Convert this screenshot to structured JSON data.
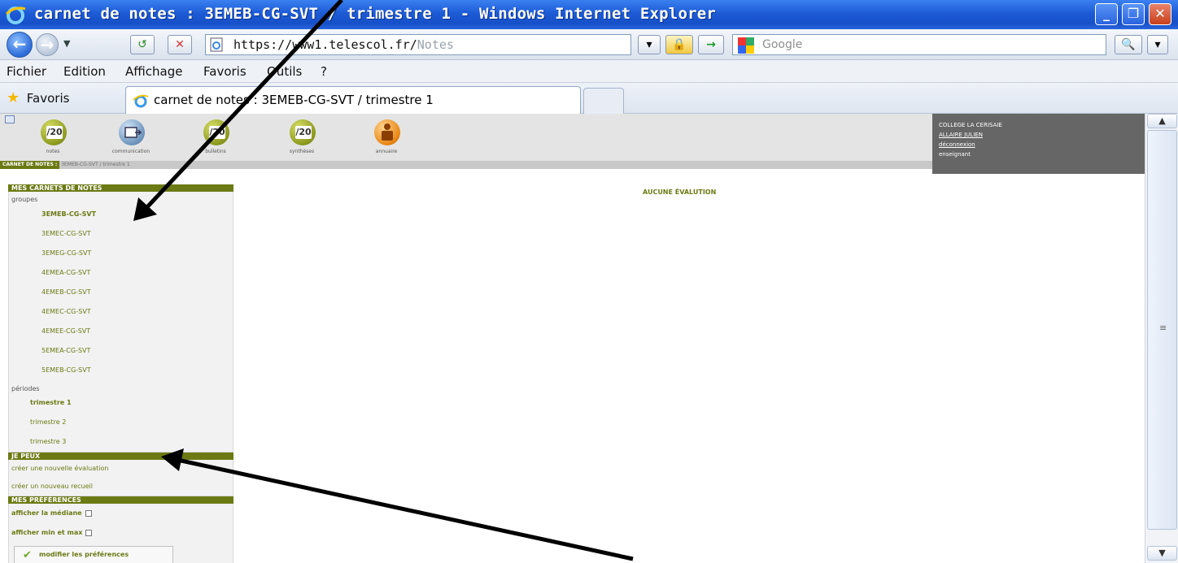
{
  "window": {
    "title": "carnet de notes : 3EMEB-CG-SVT / trimestre 1 - Windows Internet Explorer",
    "controls": [
      "_",
      "❐",
      "✕"
    ]
  },
  "addressbar": {
    "url_main": "https://www1.telescol.fr/",
    "url_tail": "Notes",
    "search_placeholder": "Google"
  },
  "menubar": [
    "Fichier",
    "Edition",
    "Affichage",
    "Favoris",
    "Outils",
    "?"
  ],
  "favbar": {
    "favorites_label": "Favoris",
    "tab_label": "carnet de notes : 3EMEB-CG-SVT / trimestre 1"
  },
  "app": {
    "nav": [
      {
        "label": "notes",
        "icon": "grade-icon",
        "mark": "/20"
      },
      {
        "label": "communication",
        "icon": "communication-icon",
        "mark": ""
      },
      {
        "label": "bulletins",
        "icon": "grade-icon",
        "mark": "/20"
      },
      {
        "label": "synthèses",
        "icon": "grade-icon",
        "mark": "/20"
      },
      {
        "label": "annuaire",
        "icon": "person-icon",
        "mark": ""
      }
    ],
    "breadcrumb": {
      "section": "CARNET DE NOTES :",
      "path": "3EMEB-CG-SVT / trimestre 1"
    },
    "college": {
      "name": "COLLEGE LA CERISAIE",
      "user": "ALLAIRE JULIEN",
      "logout": "déconnexion",
      "role": "enseignant"
    },
    "sidebar": {
      "carnets_header": "MES CARNETS DE NOTES",
      "groupes_label": "groupes",
      "groupes": [
        "3EMEB-CG-SVT",
        "3EMEC-CG-SVT",
        "3EMEG-CG-SVT",
        "4EMEA-CG-SVT",
        "4EMEB-CG-SVT",
        "4EMEC-CG-SVT",
        "4EMEE-CG-SVT",
        "5EMEA-CG-SVT",
        "5EMEB-CG-SVT"
      ],
      "periodes_label": "périodes",
      "periodes": [
        "trimestre 1",
        "trimestre 2",
        "trimestre 3"
      ],
      "jepeux_header": "JE PEUX",
      "actions": [
        "créer une nouvelle évaluation",
        "créer un nouveau recueil"
      ],
      "prefs_header": "MES PRÉFÉRENCES",
      "prefs": [
        "afficher la médiane",
        "afficher min et max"
      ],
      "modify_button": "modifier les préférences"
    },
    "main_message": "AUCUNE ÉVALUTION"
  },
  "colors": {
    "accent_olive": "#6c7a14",
    "titlebar_blue": "#1d5bd6",
    "annotation_arrow": "#000000"
  }
}
